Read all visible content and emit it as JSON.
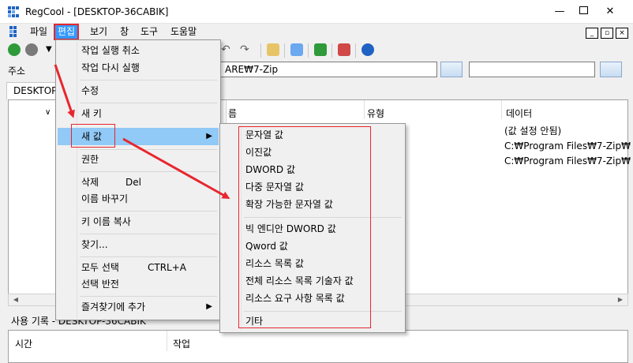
{
  "window": {
    "title": "RegCool - [DESKTOP-36CABIK]",
    "minimize": "—",
    "close": "✕"
  },
  "menubar": {
    "file": "파일",
    "edit": "편집",
    "view": "보기",
    "window": "창",
    "tools": "도구",
    "help": "도움말"
  },
  "address": {
    "label": "주소",
    "value": "ARE₩7-Zip"
  },
  "tab": {
    "label": "DESKTOP-"
  },
  "columns": {
    "name_partial": "름",
    "type": "유형",
    "data": "데이터"
  },
  "rows": [
    {
      "data": "(값 설정 안됨)"
    },
    {
      "data": "C:₩Program Files₩7-Zip₩"
    },
    {
      "data": "C:₩Program Files₩7-Zip₩"
    }
  ],
  "history": {
    "title": "사용 기록 - DESKTOP-36CABIK",
    "col_time": "시간",
    "col_action": "작업"
  },
  "edit_menu": {
    "undo": "작업 실행 취소",
    "redo": "작업 다시 실행",
    "modify": "수정",
    "new_key": "새 키",
    "new_value": "새 값",
    "permissions": "권한",
    "delete": "삭제",
    "delete_shortcut": "Del",
    "rename": "이름 바꾸기",
    "copy_key_name": "키 이름 복사",
    "find": "찾기...",
    "select_all": "모두 선택",
    "select_all_shortcut": "CTRL+A",
    "invert_selection": "선택 반전",
    "add_favorite": "즐겨찾기에 추가"
  },
  "new_value_menu": {
    "string": "문자열 값",
    "binary": "이진값",
    "dword": "DWORD 값",
    "multi_string": "다중 문자열 값",
    "expandable_string": "확장 가능한 문자열 값",
    "big_endian_dword": "빅 엔디안 DWORD 값",
    "qword": "Qword 값",
    "resource_list": "리소스 목록 값",
    "full_resource_descriptor": "전체 리소스 목록 기술자 값",
    "resource_requirements": "리소스 요구 사항 목록 값",
    "other": "기타"
  },
  "colors": {
    "highlight": "#91c9f7",
    "active_menu": "#3399ff",
    "annotation": "#e8262e"
  }
}
